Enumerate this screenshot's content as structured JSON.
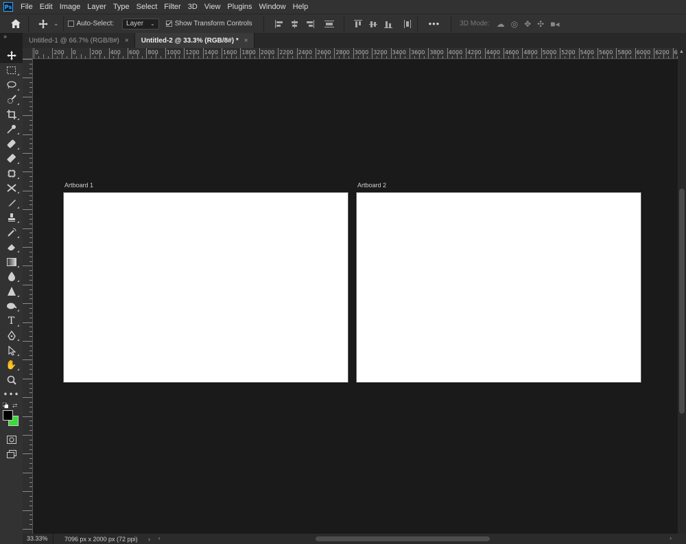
{
  "app": {
    "logo": "Ps"
  },
  "menu": [
    "File",
    "Edit",
    "Image",
    "Layer",
    "Type",
    "Select",
    "Filter",
    "3D",
    "View",
    "Plugins",
    "Window",
    "Help"
  ],
  "options": {
    "auto_select_label": "Auto-Select:",
    "auto_select_checked": false,
    "layer_dropdown": "Layer",
    "show_transform_label": "Show Transform Controls",
    "show_transform_checked": true,
    "more": "•••",
    "mode_3d_label": "3D Mode:"
  },
  "tabs": [
    {
      "label": "Untitled-1 @ 66.7% (RGB/8#)",
      "active": false,
      "close": "×"
    },
    {
      "label": "Untitled-2 @ 33.3% (RGB/8#) *",
      "active": true,
      "close": "×"
    }
  ],
  "ruler": {
    "h_labels": [
      "0",
      "200",
      "0",
      "200",
      "400",
      "600",
      "800",
      "1000",
      "1200",
      "1400",
      "1600",
      "1800",
      "2000",
      "2200",
      "2400",
      "2600",
      "2800",
      "3000",
      "3200",
      "3400",
      "3600",
      "3800",
      "4000",
      "4200",
      "4400",
      "4600",
      "4800",
      "5000",
      "5200",
      "5400",
      "5600",
      "5800",
      "6000",
      "6200",
      "64"
    ]
  },
  "artboards": [
    {
      "label": "Artboard 1",
      "fill": "#ffffff"
    },
    {
      "label": "Artboard 2",
      "fill": "#ffffff"
    }
  ],
  "toolbar": {
    "tools": [
      "move-tool",
      "marquee-tool",
      "lasso-tool",
      "quick-selection-tool",
      "crop-tool",
      "eyedropper-tool",
      "spot-healing-tool",
      "brush-tool",
      "clone-stamp-tool",
      "history-brush-tool",
      "eraser-tool",
      "gradient-tool",
      "blur-tool",
      "dodge-tool",
      "pen-tool",
      "type-tool",
      "path-selection-tool",
      "rectangle-tool",
      "hand-tool",
      "zoom-tool",
      "edit-toolbar"
    ],
    "foreground_color": "#000000",
    "background_color": "#3bd93b"
  },
  "status": {
    "zoom": "33.33%",
    "doc_info": "7096 px x 2000 px (72 ppi)"
  }
}
